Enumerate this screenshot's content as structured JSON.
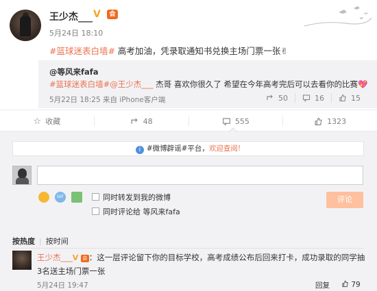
{
  "post": {
    "author": "王少杰___",
    "verified_icon": "v-badge-icon",
    "vip_icon": "vip-icon",
    "time": "5月24日 18:10",
    "tag": "#篮球迷表白墙#",
    "text": " 高考加油，凭录取通知书兑换主场门票一张",
    "emoji": "✌"
  },
  "repost": {
    "user": "@等风来fafa",
    "tag": "#篮球迷表白墙#",
    "mention": "@王少杰___",
    "text": " 杰哥 喜欢你很久了 希望在今年高考完后可以去看你的比赛",
    "emoji": "💖",
    "time": "5月22日 18:25 来自 iPhone客户端",
    "stats": {
      "reposts": "50",
      "comments": "16",
      "likes": "15"
    }
  },
  "actions": {
    "favorite": "收藏",
    "repost": "48",
    "comment": "555",
    "like": "1323"
  },
  "comment_box": {
    "notice_prefix": "#微博辟谣#平台，",
    "notice_link": "欢迎查阅!",
    "option_repost": "同时转发到我的微博",
    "option_comment": "同时评论给 等风来fafa",
    "submit": "评论"
  },
  "sort": {
    "by_hot": "按热度",
    "by_time": "按时间"
  },
  "comment": {
    "user": "王少杰___",
    "text": "：这一层评论留下你的目标学校，高考成绩公布后回来打卡，成功录取的同学抽3名送主场门票一张",
    "time": "5月24日 19:47",
    "reply": "回复",
    "likes": "79"
  },
  "colors": {
    "link": "#eb7350",
    "muted": "#808080",
    "panel": "#f2f2f5",
    "submit_bg": "#ffc09f"
  }
}
